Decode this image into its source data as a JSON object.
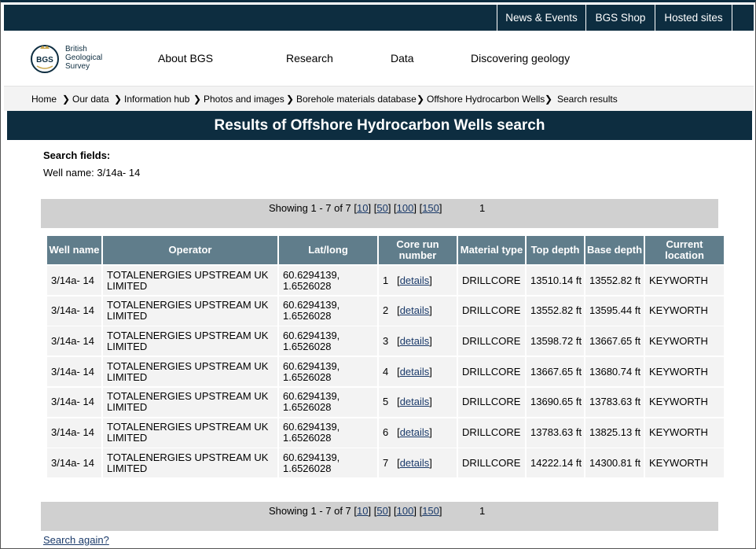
{
  "topbar": {
    "links": [
      "News & Events",
      "BGS Shop",
      "Hosted sites"
    ]
  },
  "logo": {
    "badge": "BGS",
    "lines": [
      "British",
      "Geological",
      "Survey"
    ]
  },
  "nav": {
    "items": [
      "About BGS",
      "Research",
      "Data",
      "Discovering geology"
    ]
  },
  "breadcrumb": {
    "items": [
      "Home",
      "Our data",
      "Information hub",
      "Photos and images",
      "Borehole materials database",
      "Offshore Hydrocarbon Wells",
      "Search results"
    ]
  },
  "page_title": "Results of Offshore Hydrocarbon Wells search",
  "search_fields": {
    "label": "Search fields:",
    "value": "Well name: 3/14a- 14"
  },
  "pager": {
    "showing": "Showing 1 - 7 of 7",
    "sizes": [
      "10",
      "50",
      "100",
      "150"
    ],
    "page": "1"
  },
  "table": {
    "headers": [
      "Well name",
      "Operator",
      "Lat/long",
      "Core run number",
      "Material type",
      "Top depth",
      "Base depth",
      "Current location"
    ],
    "details_label": "details",
    "rows": [
      {
        "well": "3/14a- 14",
        "operator": "TOTALENERGIES UPSTREAM UK LIMITED",
        "latlong": "60.6294139, 1.6526028",
        "run": "1",
        "material": "DRILLCORE",
        "top": "13510.14 ft",
        "base": "13552.82 ft",
        "location": "KEYWORTH"
      },
      {
        "well": "3/14a- 14",
        "operator": "TOTALENERGIES UPSTREAM UK LIMITED",
        "latlong": "60.6294139, 1.6526028",
        "run": "2",
        "material": "DRILLCORE",
        "top": "13552.82 ft",
        "base": "13595.44 ft",
        "location": "KEYWORTH"
      },
      {
        "well": "3/14a- 14",
        "operator": "TOTALENERGIES UPSTREAM UK LIMITED",
        "latlong": "60.6294139, 1.6526028",
        "run": "3",
        "material": "DRILLCORE",
        "top": "13598.72 ft",
        "base": "13667.65 ft",
        "location": "KEYWORTH"
      },
      {
        "well": "3/14a- 14",
        "operator": "TOTALENERGIES UPSTREAM UK LIMITED",
        "latlong": "60.6294139, 1.6526028",
        "run": "4",
        "material": "DRILLCORE",
        "top": "13667.65 ft",
        "base": "13680.74 ft",
        "location": "KEYWORTH"
      },
      {
        "well": "3/14a- 14",
        "operator": "TOTALENERGIES UPSTREAM UK LIMITED",
        "latlong": "60.6294139, 1.6526028",
        "run": "5",
        "material": "DRILLCORE",
        "top": "13690.65 ft",
        "base": "13783.63 ft",
        "location": "KEYWORTH"
      },
      {
        "well": "3/14a- 14",
        "operator": "TOTALENERGIES UPSTREAM UK LIMITED",
        "latlong": "60.6294139, 1.6526028",
        "run": "6",
        "material": "DRILLCORE",
        "top": "13783.63 ft",
        "base": "13825.13 ft",
        "location": "KEYWORTH"
      },
      {
        "well": "3/14a- 14",
        "operator": "TOTALENERGIES UPSTREAM UK LIMITED",
        "latlong": "60.6294139, 1.6526028",
        "run": "7",
        "material": "DRILLCORE",
        "top": "14222.14 ft",
        "base": "14300.81 ft",
        "location": "KEYWORTH"
      }
    ]
  },
  "search_again": "Search again?",
  "colors": {
    "brand_dark": "#0d2d40",
    "table_header": "#607d8b",
    "row_bg": "#f3f3f3",
    "pager_bg": "#d0d0d0",
    "link": "#1a3a6a"
  }
}
